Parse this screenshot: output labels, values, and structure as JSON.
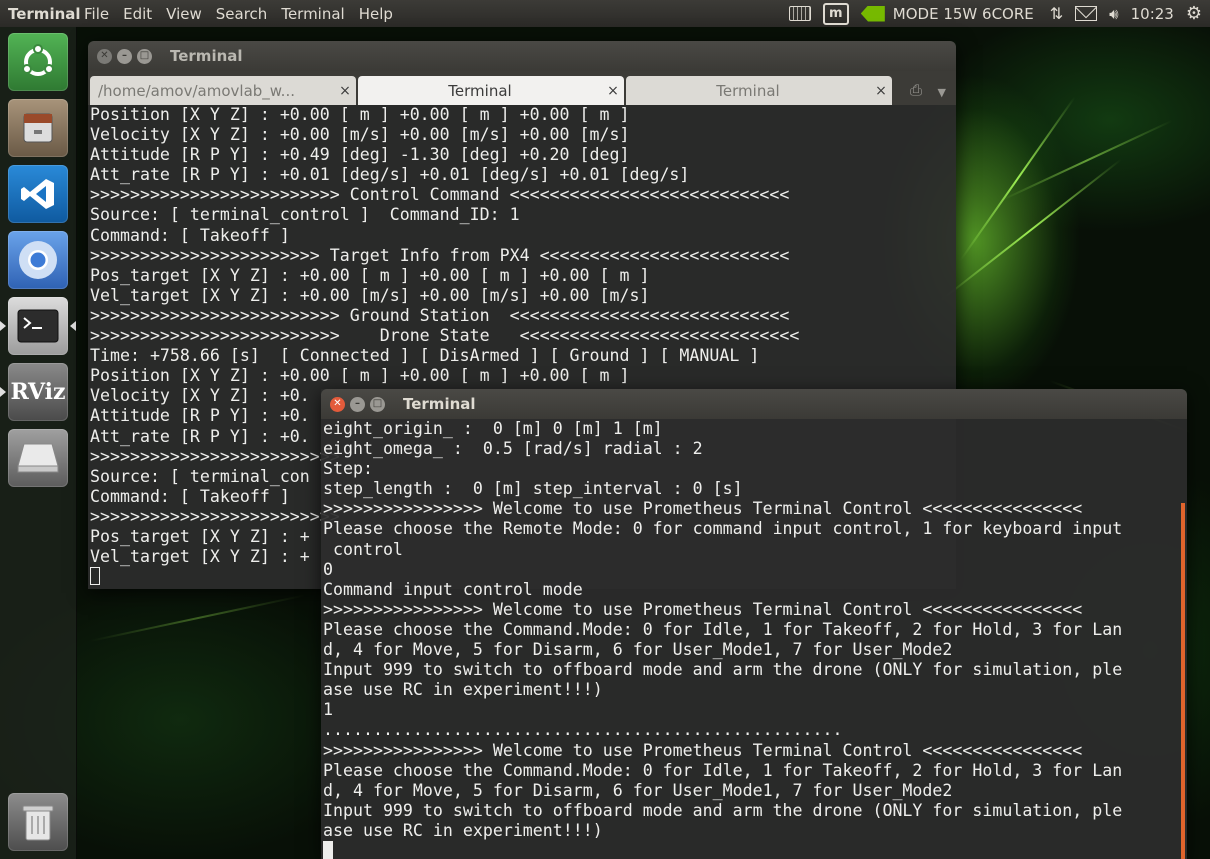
{
  "top_panel": {
    "app_name": "Terminal",
    "menus": [
      "File",
      "Edit",
      "View",
      "Search",
      "Terminal",
      "Help"
    ],
    "nvidia_mode": "MODE 15W 6CORE",
    "clock": "10:23",
    "icons": [
      "keyboard-icon",
      "m-indicator-icon",
      "nvidia-icon",
      "network-updown-icon",
      "mail-icon",
      "volume-icon",
      "settings-gear-icon"
    ]
  },
  "launcher": {
    "items": [
      {
        "name": "ubuntu-dash",
        "color": "#3b8a3e"
      },
      {
        "name": "files",
        "color": "#7a6b57"
      },
      {
        "name": "vscode",
        "color": "#1a74c4"
      },
      {
        "name": "chromium",
        "color": "#3d7bd6"
      },
      {
        "name": "terminal",
        "color": "#4e4e4e"
      },
      {
        "name": "rviz",
        "color": "#5a5a5a"
      },
      {
        "name": "drive",
        "color": "#6a6a6a"
      },
      {
        "name": "trash",
        "color": "#5f5f5f"
      }
    ],
    "rviz_label": "RViz"
  },
  "back_window": {
    "title": "Terminal",
    "tabs": [
      {
        "label": "/home/amov/amovlab_w...",
        "active": false
      },
      {
        "label": "Terminal",
        "active": true
      },
      {
        "label": "Terminal",
        "active": false
      }
    ],
    "lines": [
      "Position [X Y Z] : +0.00 [ m ] +0.00 [ m ] +0.00 [ m ]",
      "Velocity [X Y Z] : +0.00 [m/s] +0.00 [m/s] +0.00 [m/s]",
      "Attitude [R P Y] : +0.49 [deg] -1.30 [deg] +0.20 [deg]",
      "Att_rate [R P Y] : +0.01 [deg/s] +0.01 [deg/s] +0.01 [deg/s]",
      ">>>>>>>>>>>>>>>>>>>>>>>>> Control Command <<<<<<<<<<<<<<<<<<<<<<<<<<<<",
      "Source: [ terminal_control ]  Command_ID: 1",
      "Command: [ Takeoff ]",
      ">>>>>>>>>>>>>>>>>>>>>>> Target Info from PX4 <<<<<<<<<<<<<<<<<<<<<<<<<",
      "Pos_target [X Y Z] : +0.00 [ m ] +0.00 [ m ] +0.00 [ m ]",
      "Vel_target [X Y Z] : +0.00 [m/s] +0.00 [m/s] +0.00 [m/s]",
      ">>>>>>>>>>>>>>>>>>>>>>>>> Ground Station  <<<<<<<<<<<<<<<<<<<<<<<<<<<<",
      ">>>>>>>>>>>>>>>>>>>>>>>>>    Drone State   <<<<<<<<<<<<<<<<<<<<<<<<<<<<",
      "Time: +758.66 [s]  [ Connected ] [ DisArmed ] [ Ground ] [ MANUAL ]",
      "Position [X Y Z] : +0.00 [ m ] +0.00 [ m ] +0.00 [ m ]",
      "Velocity [X Y Z] : +0.",
      "Attitude [R P Y] : +0.",
      "Att_rate [R P Y] : +0.",
      ">>>>>>>>>>>>>>>>>>>>>>>>>",
      "Source: [ terminal_con",
      "Command: [ Takeoff ]",
      ">>>>>>>>>>>>>>>>>>>>>>>>>",
      "Pos_target [X Y Z] : +",
      "Vel_target [X Y Z] : +"
    ]
  },
  "front_window": {
    "title": "Terminal",
    "lines": [
      "eight_origin_ :  0 [m] 0 [m] 1 [m]",
      "eight_omega_ :  0.5 [rad/s] radial : 2",
      "Step:",
      "step_length :  0 [m] step_interval : 0 [s]",
      ">>>>>>>>>>>>>>>> Welcome to use Prometheus Terminal Control <<<<<<<<<<<<<<<<",
      "Please choose the Remote Mode: 0 for command input control, 1 for keyboard input",
      " control",
      "0",
      "Command input control mode",
      ">>>>>>>>>>>>>>>> Welcome to use Prometheus Terminal Control <<<<<<<<<<<<<<<<",
      "Please choose the Command.Mode: 0 for Idle, 1 for Takeoff, 2 for Hold, 3 for Lan",
      "d, 4 for Move, 5 for Disarm, 6 for User_Mode1, 7 for User_Mode2",
      "Input 999 to switch to offboard mode and arm the drone (ONLY for simulation, ple",
      "ase use RC in experiment!!!)",
      "1",
      "....................................................",
      ">>>>>>>>>>>>>>>> Welcome to use Prometheus Terminal Control <<<<<<<<<<<<<<<<",
      "Please choose the Command.Mode: 0 for Idle, 1 for Takeoff, 2 for Hold, 3 for Lan",
      "d, 4 for Move, 5 for Disarm, 6 for User_Mode1, 7 for User_Mode2",
      "Input 999 to switch to offboard mode and arm the drone (ONLY for simulation, ple",
      "ase use RC in experiment!!!)"
    ],
    "scrollbar_color": "#e0642c"
  }
}
